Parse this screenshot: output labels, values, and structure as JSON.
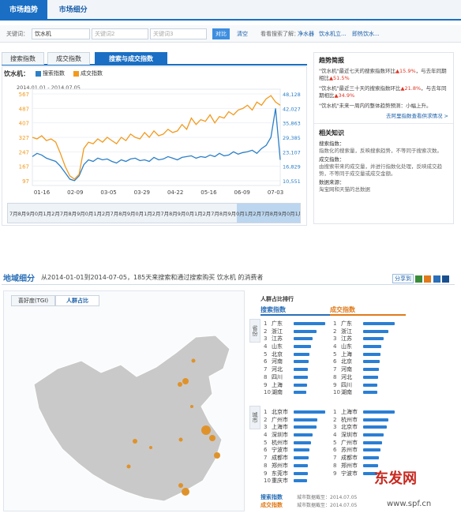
{
  "nav": {
    "tabs": [
      "市场趋势",
      "市场细分"
    ]
  },
  "keywords": {
    "label": "关键词：",
    "kw1": "饮水机",
    "kw2_placeholder": "关键词2",
    "kw3_placeholder": "关键词3",
    "compare": "对比",
    "clear": "清空",
    "recommend_label": "看看搜索了解：",
    "rec1": "净水器",
    "rec2": "饮水机立...",
    "rec3": "即热饮水..."
  },
  "chart_tabs": [
    "搜索指数",
    "成交指数",
    "搜索与成交指数"
  ],
  "chart": {
    "keyword": "饮水机：",
    "legend_search": "搜索指数",
    "legend_deal": "成交指数",
    "range": "2014.01.01 - 2014.07.05",
    "color_search": "#2c7fc8",
    "color_deal": "#f29a1e"
  },
  "chart_data": {
    "type": "line",
    "x_ticks": [
      "01-16",
      "02-09",
      "03-05",
      "03-29",
      "04-22",
      "05-16",
      "06-09",
      "07-03"
    ],
    "left_ticks": [
      "567",
      "487",
      "407",
      "327",
      "247",
      "167",
      "97"
    ],
    "right_ticks": [
      "48,128",
      "42,027",
      "35,863",
      "29,385",
      "23,107",
      "16,829",
      "10,551"
    ],
    "series": [
      {
        "name": "搜索指数",
        "values": [
          180,
          200,
          190,
          170,
          160,
          150,
          120,
          80,
          40,
          30,
          60,
          130,
          160,
          150,
          170,
          160,
          165,
          150,
          140,
          160,
          150,
          165,
          170,
          155,
          160,
          150,
          175,
          160,
          165,
          180,
          170,
          160,
          175,
          180,
          185,
          170,
          180,
          175,
          190,
          180,
          200,
          185,
          190,
          210,
          195,
          205,
          210,
          220,
          200,
          230,
          250,
          300,
          480,
          160
        ]
      },
      {
        "name": "成交指数",
        "values": [
          300,
          290,
          310,
          280,
          290,
          270,
          200,
          120,
          60,
          40,
          70,
          230,
          270,
          260,
          290,
          270,
          300,
          280,
          260,
          300,
          280,
          320,
          300,
          290,
          330,
          300,
          340,
          310,
          320,
          350,
          330,
          340,
          380,
          350,
          420,
          380,
          410,
          400,
          440,
          390,
          430,
          420,
          460,
          440,
          470,
          480,
          500,
          470,
          520,
          500,
          540,
          560,
          520,
          500
        ]
      }
    ],
    "timeline_label": "7月8月9月0月1月2月"
  },
  "trend": {
    "title": "趋势简报",
    "p1a": "\"饮水机\"最近七天的搜索指数环比",
    "p1b": "15.9%",
    "p1c": "，与去年同期相比",
    "p1d": "51.5%",
    "p2a": "\"饮水机\"最近三十天的搜索指数环比",
    "p2b": "21.8%",
    "p2c": "，与去年同期相比",
    "p2d": "34.9%",
    "p3": "\"饮水机\"未来一周内的整体趋势预测：小幅上升。",
    "link": "去阿里指数查看供求情况 >"
  },
  "knowledge": {
    "title": "相关知识",
    "t1": "搜索指数：",
    "d1": "指数化的搜索量，反映搜索趋势，不等同于搜索次数。",
    "t2": "成交指数：",
    "d2": "由搜索带来的成交量，并进行指数化处理，反映成交趋势，不等同于成交量或成交金额。",
    "t3": "数据来源：",
    "d3": "淘宝网和天猫的总数据"
  },
  "region": {
    "title": "地域细分",
    "subtitle": "从2014-01-01到2014-07-05，185天来搜索和通过搜索购买 饮水机 的消费者",
    "share": "分享到",
    "map_tabs": [
      "喜好度(TGI)",
      "人群占比"
    ],
    "rank_title": "人群占比排行",
    "col_search": "搜索指数",
    "col_deal": "成交指数",
    "grp_province": "省份",
    "grp_city": "城市",
    "prov_search": [
      "广东",
      "浙江",
      "江苏",
      "山东",
      "北京",
      "河南",
      "河北",
      "四川",
      "上海",
      "湖南"
    ],
    "prov_search_v": [
      1.0,
      0.72,
      0.6,
      0.55,
      0.5,
      0.48,
      0.46,
      0.44,
      0.42,
      0.4
    ],
    "prov_deal": [
      "广东",
      "浙江",
      "江苏",
      "山东",
      "上海",
      "北京",
      "河南",
      "河北",
      "四川",
      "湖南"
    ],
    "prov_deal_v": [
      1.0,
      0.8,
      0.66,
      0.58,
      0.55,
      0.52,
      0.5,
      0.48,
      0.46,
      0.44
    ],
    "city_search": [
      "北京市",
      "广州市",
      "上海市",
      "深圳市",
      "杭州市",
      "宁波市",
      "成都市",
      "郑州市",
      "东莞市",
      "重庆市"
    ],
    "city_search_v": [
      1.0,
      0.75,
      0.72,
      0.6,
      0.56,
      0.5,
      0.48,
      0.46,
      0.44,
      0.42
    ],
    "city_deal": [
      "上海市",
      "杭州市",
      "北京市",
      "深圳市",
      "广州市",
      "苏州市",
      "成都市",
      "郑州市",
      "宁波市",
      ""
    ],
    "city_deal_v": [
      1.0,
      0.8,
      0.75,
      0.65,
      0.6,
      0.55,
      0.5,
      0.48,
      0.46,
      0
    ],
    "foot1": "搜索指数",
    "foot2": "成交指数",
    "foot3": "城市数据截至：2014.07.05",
    "foot4": "城市数据截至：2014.07.05",
    "watermark1": "东发网",
    "watermark2": "www.spf.cn"
  }
}
